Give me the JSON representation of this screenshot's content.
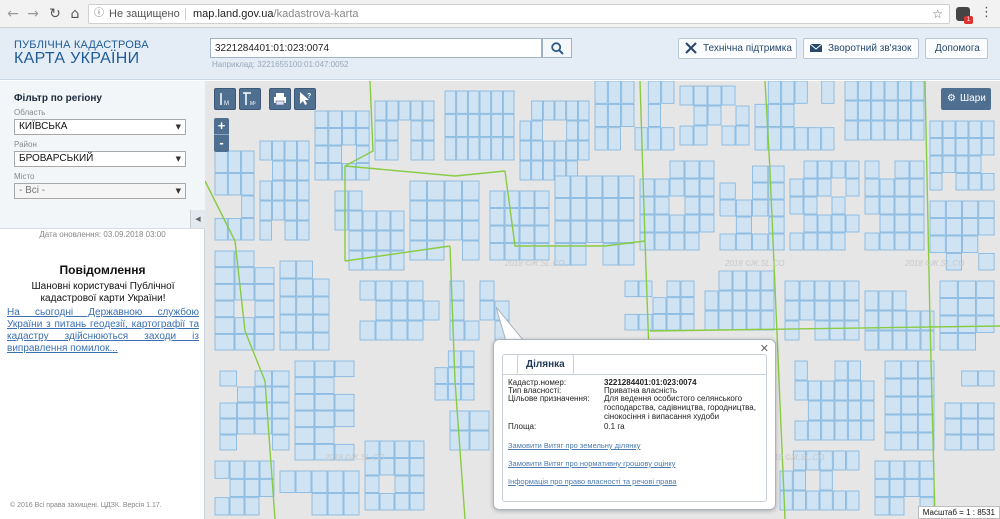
{
  "browser": {
    "back_icon": "back-arrow-icon",
    "forward_icon": "forward-arrow-icon",
    "reload_icon": "reload-icon",
    "home_icon": "home-icon",
    "security_text": "Не защищено",
    "url_host": "map.land.gov.ua",
    "url_path": "/kadastrova-karta",
    "ext_badge": "1"
  },
  "header": {
    "logo_line1": "ПУБЛІЧНА КАДАСТРОВА",
    "logo_line2": "КАРТА УКРАЇНИ",
    "search_value": "3221284401:01:023:0074",
    "search_example": "Наприклад: 3221655100:01:047:0052",
    "buttons": {
      "support": "Технічна підтримка",
      "feedback": "Зворотний зв'язок",
      "help": "Допомога"
    }
  },
  "sidebar": {
    "filter_title": "Фільтр по регіону",
    "oblast_label": "Область",
    "oblast_value": "КИЇВСЬКА",
    "raion_label": "Район",
    "raion_value": "БРОВАРСЬКИЙ",
    "misto_label": "Місто",
    "misto_value": "- Всі -",
    "update_date": "Дата оновлення: 03.09.2018 03:00",
    "notice_title": "Повідомлення",
    "notice_text": "Шановні користувачі Публічної кадастрової карти України!",
    "notice_link": "На сьогодні Державною службою України з питань геодезії, картографії та кадастру здійснюються заходи із виправлення помилок...",
    "copyright": "© 2016 Всі права захищені. ЦДЗК. Версія 1.17."
  },
  "map": {
    "layers_label": "Шари",
    "zoom_in": "+",
    "zoom_out": "-",
    "scale": "Масштаб = 1 : 8531",
    "watermark": "2018 ©Ж.SL.CO"
  },
  "popup": {
    "tab": "Ділянка",
    "rows": [
      {
        "key": "Кадастр.номер:",
        "value": "3221284401:01:023:0074"
      },
      {
        "key": "Тип власності:",
        "value": "Приватна власність"
      },
      {
        "key": "Цільове призначення:",
        "value": "Для ведення особистого селянського господарства, садівництва, городництва, сінокосіння і випасання худоби"
      },
      {
        "key": "Площа:",
        "value": "0.1 га"
      }
    ],
    "links": [
      "Замовити Витяг про земельну ділянку",
      "Замовити Витяг про нормативну грошову оцінку",
      "Інформація про право власності та речові права"
    ]
  },
  "colors": {
    "parcel_fill": "#cfe3f3",
    "parcel_stroke": "#7fb4df",
    "boundary_green": "#88cc44",
    "header_bg": "#e4ecf5",
    "map_button": "#4f6f91"
  }
}
